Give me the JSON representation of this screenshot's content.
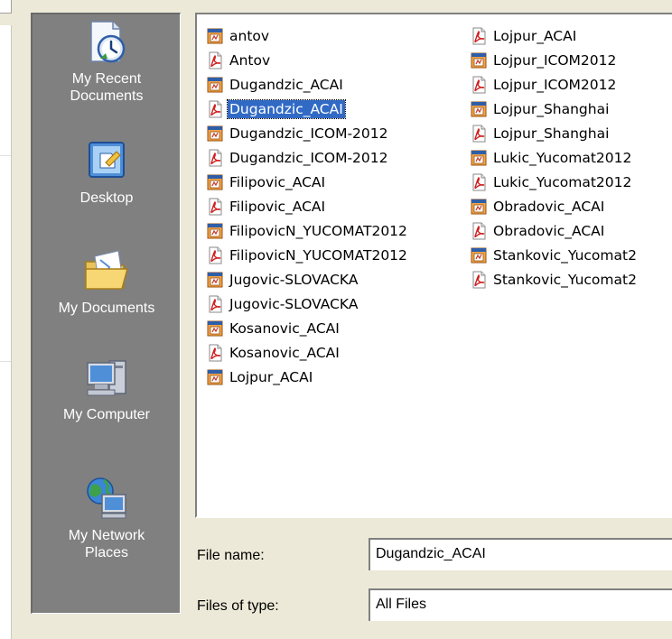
{
  "places": [
    {
      "label_line1": "My Recent",
      "label_line2": "Documents",
      "icon": "recent-documents-icon"
    },
    {
      "label_line1": "Desktop",
      "label_line2": "",
      "icon": "desktop-icon"
    },
    {
      "label_line1": "My Documents",
      "label_line2": "",
      "icon": "my-documents-folder-icon"
    },
    {
      "label_line1": "My Computer",
      "label_line2": "",
      "icon": "my-computer-icon"
    },
    {
      "label_line1": "My Network",
      "label_line2": "Places",
      "icon": "network-places-icon"
    }
  ],
  "files_col1": [
    {
      "name": "antov",
      "type": "ppt"
    },
    {
      "name": "Antov",
      "type": "pdf"
    },
    {
      "name": "Dugandzic_ACAI",
      "type": "ppt"
    },
    {
      "name": "Dugandzic_ACAI",
      "type": "pdf",
      "selected": true
    },
    {
      "name": "Dugandzic_ICOM-2012",
      "type": "ppt"
    },
    {
      "name": "Dugandzic_ICOM-2012",
      "type": "pdf"
    },
    {
      "name": "Filipovic_ACAI",
      "type": "ppt"
    },
    {
      "name": "Filipovic_ACAI",
      "type": "pdf"
    },
    {
      "name": "FilipovicN_YUCOMAT2012",
      "type": "ppt"
    },
    {
      "name": "FilipovicN_YUCOMAT2012",
      "type": "pdf"
    },
    {
      "name": "Jugovic-SLOVACKA",
      "type": "ppt"
    },
    {
      "name": "Jugovic-SLOVACKA",
      "type": "pdf"
    },
    {
      "name": "Kosanovic_ACAI",
      "type": "ppt"
    },
    {
      "name": "Kosanovic_ACAI",
      "type": "pdf"
    },
    {
      "name": "Lojpur_ACAI",
      "type": "ppt"
    }
  ],
  "files_col2": [
    {
      "name": "Lojpur_ACAI",
      "type": "pdf"
    },
    {
      "name": "Lojpur_ICOM2012",
      "type": "ppt"
    },
    {
      "name": "Lojpur_ICOM2012",
      "type": "pdf"
    },
    {
      "name": "Lojpur_Shanghai",
      "type": "ppt"
    },
    {
      "name": "Lojpur_Shanghai",
      "type": "pdf"
    },
    {
      "name": "Lukic_Yucomat2012",
      "type": "ppt"
    },
    {
      "name": "Lukic_Yucomat2012",
      "type": "pdf"
    },
    {
      "name": "Obradovic_ACAI",
      "type": "ppt"
    },
    {
      "name": "Obradovic_ACAI",
      "type": "pdf"
    },
    {
      "name": "Stankovic_Yucomat2",
      "type": "ppt"
    },
    {
      "name": "Stankovic_Yucomat2",
      "type": "pdf"
    }
  ],
  "form": {
    "file_name_label": "File name:",
    "file_name_value": "Dugandzic_ACAI",
    "file_type_label": "Files of type:",
    "file_type_value": "All Files"
  },
  "colors": {
    "places_bg": "#808080",
    "selection": "#316ac5",
    "dialog_bg": "#ece9d8"
  }
}
